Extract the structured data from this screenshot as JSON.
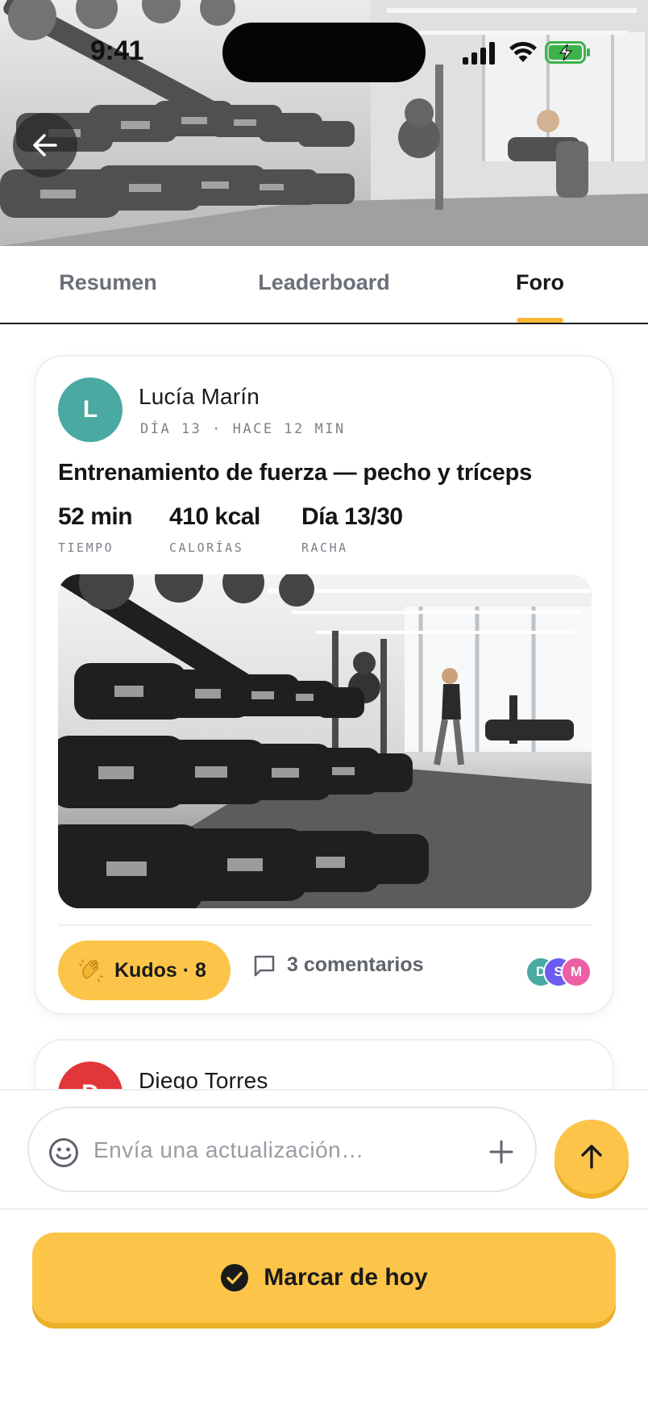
{
  "status_bar": {
    "time": "9:41",
    "icons": [
      "cellular-signal-icon",
      "wifi-icon",
      "battery-charging-icon"
    ]
  },
  "header": {
    "back_icon": "arrow-left-icon"
  },
  "tabs": [
    {
      "label": "Resumen",
      "active": false
    },
    {
      "label": "Leaderboard",
      "active": false
    },
    {
      "label": "Foro",
      "active": true
    }
  ],
  "posts": [
    {
      "avatar_initial": "L",
      "avatar_color": "#4aa9a0",
      "author": "Lucía Marín",
      "meta": "DÍA 13 · HACE 12 MIN",
      "title": "Entrenamiento de fuerza — pecho y tríceps",
      "stats": [
        {
          "value": "52 min",
          "label": "TIEMPO"
        },
        {
          "value": "410 kcal",
          "label": "CALORÍAS"
        },
        {
          "value": "Día 13/30",
          "label": "RACHA"
        }
      ],
      "kudos_label": "Kudos · 8",
      "comments_label": "3 comentarios",
      "reactors": [
        {
          "initial": "D",
          "color": "#4aa9a0"
        },
        {
          "initial": "S",
          "color": "#6b5cf0"
        },
        {
          "initial": "M",
          "color": "#ec5fa6"
        }
      ]
    },
    {
      "avatar_initial": "D",
      "avatar_color": "#e2373a",
      "author": "Diego Torres"
    }
  ],
  "composer": {
    "placeholder": "Envía una actualización…"
  },
  "cta": {
    "label": "Marcar de hoy"
  },
  "colors": {
    "accent": "#fcc54a",
    "accent_shadow": "#eab128",
    "tab_underline": "#f7b733",
    "text_primary": "#1a1a1a",
    "text_muted": "#7d8088"
  }
}
